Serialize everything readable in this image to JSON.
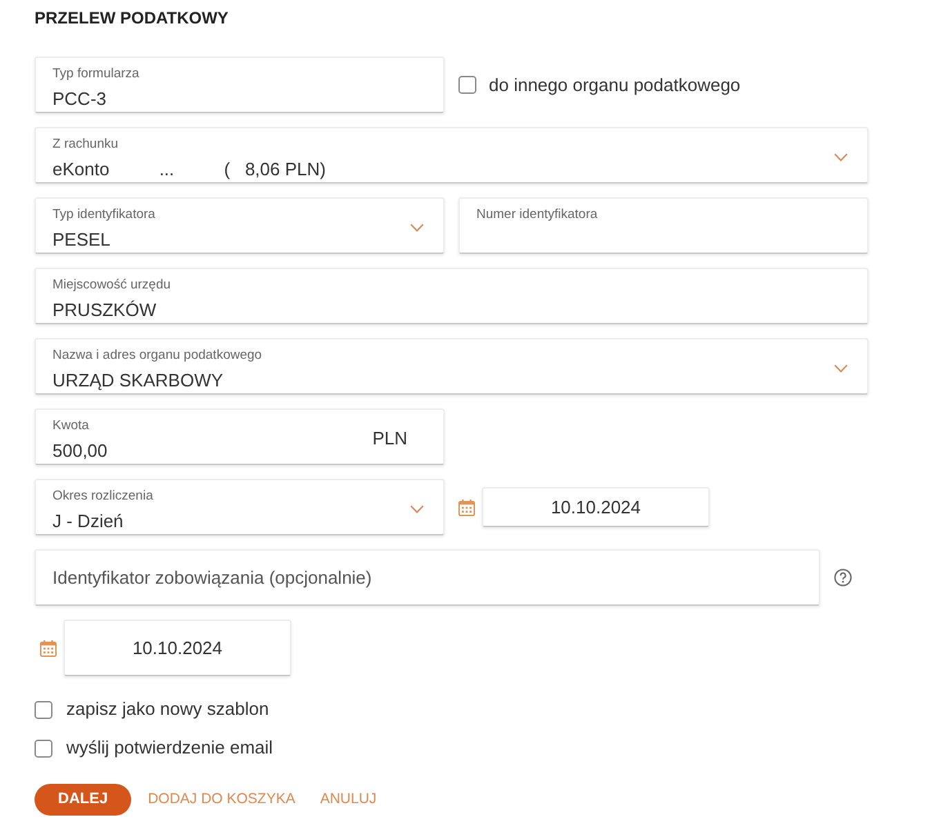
{
  "title": "PRZELEW PODATKOWY",
  "rows": [
    [
      {
        "kind": "text",
        "label": "Typ formularza",
        "value": "PCC-3"
      },
      {
        "kind": "checkbox",
        "label": "do innego organu podatkowego",
        "checked": false
      }
    ],
    [
      {
        "kind": "select",
        "label": "Z rachunku",
        "value": "eKonto          ...          (   8,06 PLN)"
      }
    ],
    [
      {
        "kind": "select",
        "label": "Typ identyfikatora",
        "value": "PESEL"
      },
      {
        "kind": "text",
        "label": "Numer identyfikatora"
      }
    ],
    [
      {
        "kind": "text",
        "label": "Miejscowość urzędu",
        "value": "PRUSZKÓW"
      }
    ],
    [
      {
        "kind": "select",
        "label": "Nazwa i adres organu podatkowego",
        "value": "URZĄD SKARBOWY"
      }
    ],
    [
      {
        "kind": "amount",
        "label": "Kwota",
        "value": "500,00",
        "currency": "PLN"
      }
    ],
    [
      {
        "kind": "select",
        "label": "Okres rozliczenia",
        "value": "J - Dzień"
      },
      {
        "kind": "date",
        "value": "10.10.2024"
      }
    ],
    [
      {
        "kind": "text",
        "placeholder": "Identyfikator zobowiązania (opcjonalnie)",
        "help": true
      }
    ],
    [
      {
        "kind": "date",
        "value": "10.10.2024"
      }
    ]
  ],
  "options": [
    {
      "label": "zapisz jako nowy szablon",
      "checked": false
    },
    {
      "label": "wyślij potwierdzenie email",
      "checked": false
    }
  ],
  "actions": [
    {
      "kind": "primary",
      "label": "DALEJ"
    },
    {
      "kind": "link",
      "label": "DODAJ DO KOSZYKA"
    },
    {
      "kind": "link",
      "label": "ANULUJ"
    }
  ]
}
